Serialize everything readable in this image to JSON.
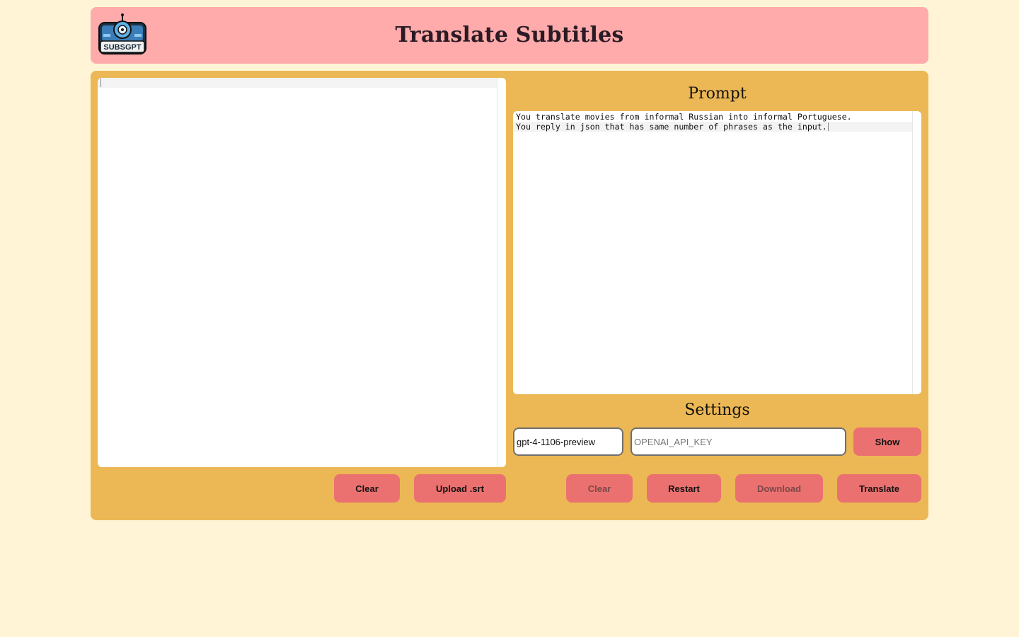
{
  "header": {
    "title": "Translate Subtitles",
    "logo_text": "SUBSGPT"
  },
  "source_editor": {
    "content": ""
  },
  "prompt": {
    "heading": "Prompt",
    "lines": [
      "You translate movies from informal Russian into informal Portuguese.",
      "You reply in json that has same number of phrases as the input."
    ]
  },
  "settings": {
    "heading": "Settings",
    "model_value": "gpt-4-1106-preview",
    "api_key_placeholder": "OPENAI_API_KEY",
    "show_label": "Show"
  },
  "left_actions": {
    "clear_label": "Clear",
    "upload_label": "Upload .srt"
  },
  "right_actions": {
    "clear_label": "Clear",
    "restart_label": "Restart",
    "download_label": "Download",
    "translate_label": "Translate"
  },
  "colors": {
    "page_bg": "#fff5d6",
    "header_bg": "#ffaaab",
    "panel_bg": "#ecb855",
    "button_bg": "#eb7170"
  }
}
